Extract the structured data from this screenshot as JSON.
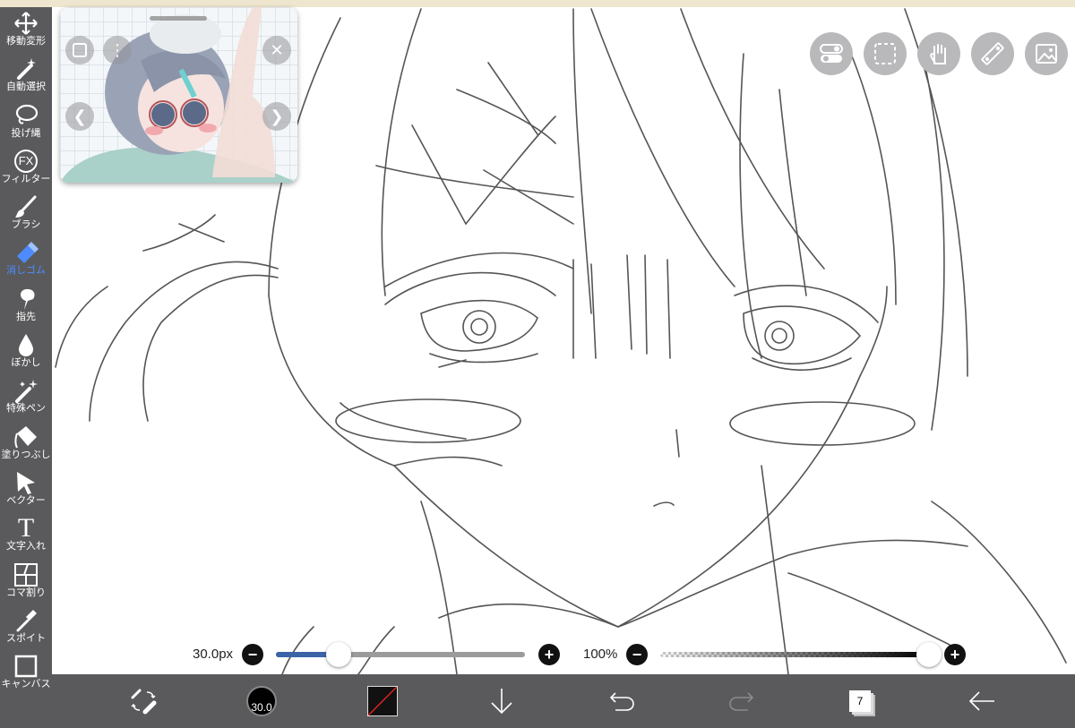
{
  "toolbar": {
    "items": [
      {
        "label": "移動変形",
        "icon": "move-icon"
      },
      {
        "label": "自動選択",
        "icon": "magic-wand-icon"
      },
      {
        "label": "投げ縄",
        "icon": "lasso-icon"
      },
      {
        "label": "フィルター",
        "icon": "fx-icon",
        "icon_text": "FX"
      },
      {
        "label": "ブラシ",
        "icon": "brush-icon"
      },
      {
        "label": "消しゴム",
        "icon": "eraser-icon"
      },
      {
        "label": "指先",
        "icon": "smudge-icon"
      },
      {
        "label": "ぼかし",
        "icon": "blur-icon"
      },
      {
        "label": "特殊ペン",
        "icon": "special-pen-icon"
      },
      {
        "label": "塗りつぶし",
        "icon": "fill-icon"
      },
      {
        "label": "ベクター",
        "icon": "vector-icon"
      },
      {
        "label": "文字入れ",
        "icon": "text-icon",
        "icon_text": "T"
      },
      {
        "label": "コマ割り",
        "icon": "panel-icon"
      },
      {
        "label": "スポイト",
        "icon": "eyedropper-icon"
      },
      {
        "label": "キャンバス",
        "icon": "canvas-icon"
      }
    ],
    "active_tool": "消しゴム"
  },
  "sliders": {
    "size_value": "30.0px",
    "size_fraction": 0.25,
    "opacity_value": "100%",
    "opacity_fraction": 1.0
  },
  "bottom_bar": {
    "brush_size": "30.0",
    "layer_count": "7"
  },
  "colors": {
    "toolbar_bg": "#5a5a5c",
    "active": "#4d8bff",
    "slider_fill": "#3b64a8"
  }
}
